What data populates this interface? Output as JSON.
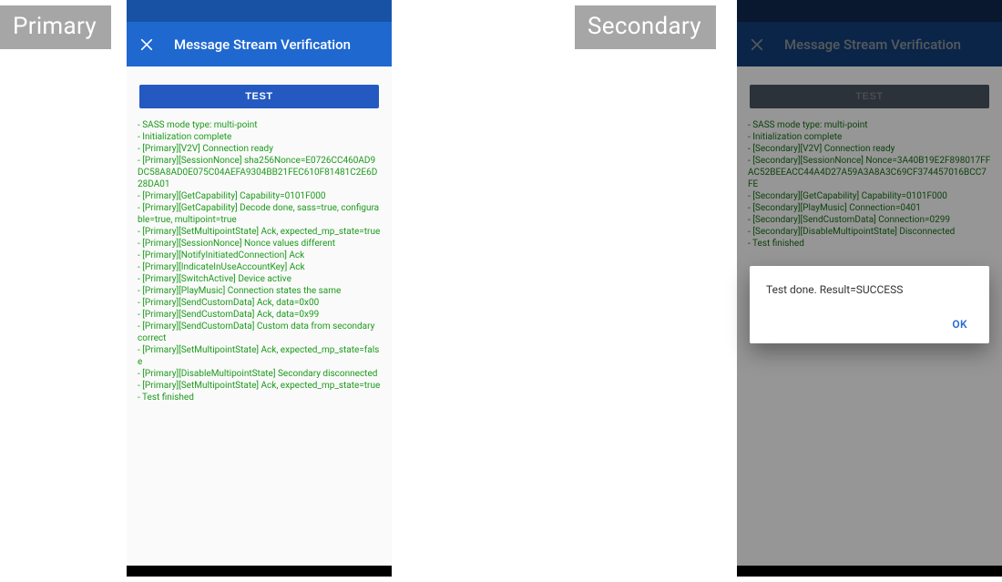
{
  "labels": {
    "primary": "Primary",
    "secondary": "Secondary"
  },
  "appbar": {
    "title": "Message Stream Verification"
  },
  "button": {
    "test": "TEST"
  },
  "dialog": {
    "message": "Test done. Result=SUCCESS",
    "ok": "OK"
  },
  "primary_log": [
    " - SASS mode type: multi-point",
    " - Initialization complete",
    " - [Primary][V2V] Connection ready",
    " - [Primary][SessionNonce] sha256Nonce=E0726CC460AD9DC58A8AD0E075C04AEFA9304BB21FEC610F81481C2E6D28DA01",
    " - [Primary][GetCapability] Capability=0101F000",
    " - [Primary][GetCapability] Decode done, sass=true, configurable=true, multipoint=true",
    " - [Primary][SetMultipointState] Ack, expected_mp_state=true",
    " - [Primary][SessionNonce] Nonce values different",
    " - [Primary][NotifyInitiatedConnection] Ack",
    " - [Primary][IndicateInUseAccountKey] Ack",
    " - [Primary][SwitchActive] Device active",
    " - [Primary][PlayMusic] Connection states the same",
    " - [Primary][SendCustomData] Ack, data=0x00",
    " - [Primary][SendCustomData] Ack, data=0x99",
    " - [Primary][SendCustomData] Custom data from secondary correct",
    " - [Primary][SetMultipointState] Ack, expected_mp_state=false",
    " - [Primary][DisableMultipointState] Secondary disconnected",
    " - [Primary][SetMultipointState] Ack, expected_mp_state=true",
    " - Test finished"
  ],
  "secondary_log": [
    " - SASS mode type: multi-point",
    " - Initialization complete",
    " - [Secondary][V2V] Connection ready",
    " - [Secondary][SessionNonce] Nonce=3A40B19E2F898017FFAC52BEEACC44A4D27A59A3A8A3C69CF374457016BCC7FE",
    " - [Secondary][GetCapability] Capability=0101F000",
    " - [Secondary][PlayMusic] Connection=0401",
    " - [Secondary][SendCustomData] Connection=0299",
    " - [Secondary][DisableMultipointState] Disconnected",
    " - Test finished"
  ]
}
